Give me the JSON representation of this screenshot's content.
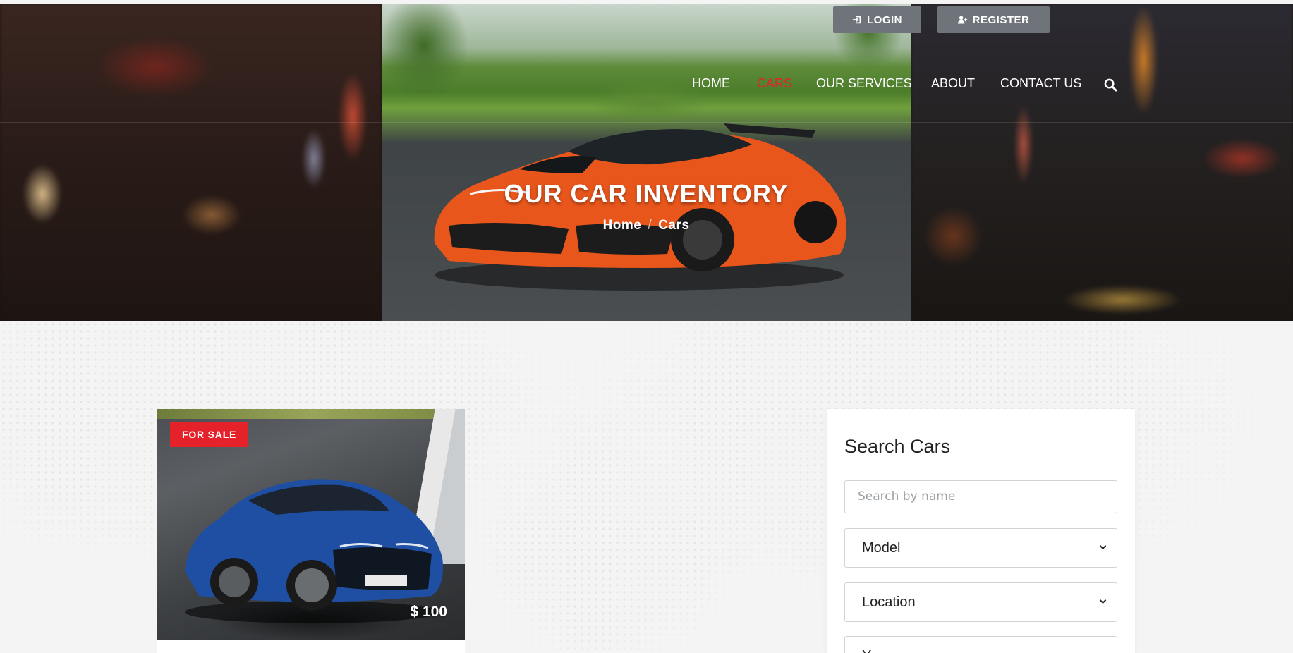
{
  "header": {
    "login_label": "LOGIN",
    "register_label": "REGISTER",
    "nav": {
      "home": "HOME",
      "cars": "CARS",
      "services": "OUR SERVICES",
      "about": "ABOUT",
      "contact": "CONTACT US"
    },
    "active_nav": "cars",
    "icons": {
      "login": "sign-in-icon",
      "register": "user-plus-icon",
      "search": "search-icon"
    }
  },
  "hero": {
    "title": "OUR CAR INVENTORY",
    "breadcrumb": {
      "home": "Home",
      "separator": "/",
      "current": "Cars"
    }
  },
  "listing": {
    "badge": "FOR SALE",
    "price": "$ 100"
  },
  "search": {
    "title": "Search Cars",
    "name_placeholder": "Search by name",
    "model_label": "Model",
    "location_label": "Location",
    "year_label": "Y"
  },
  "colors": {
    "accent": "#e5222a",
    "button_bg": "#6e7479",
    "page_bg": "#f4f4f4"
  }
}
